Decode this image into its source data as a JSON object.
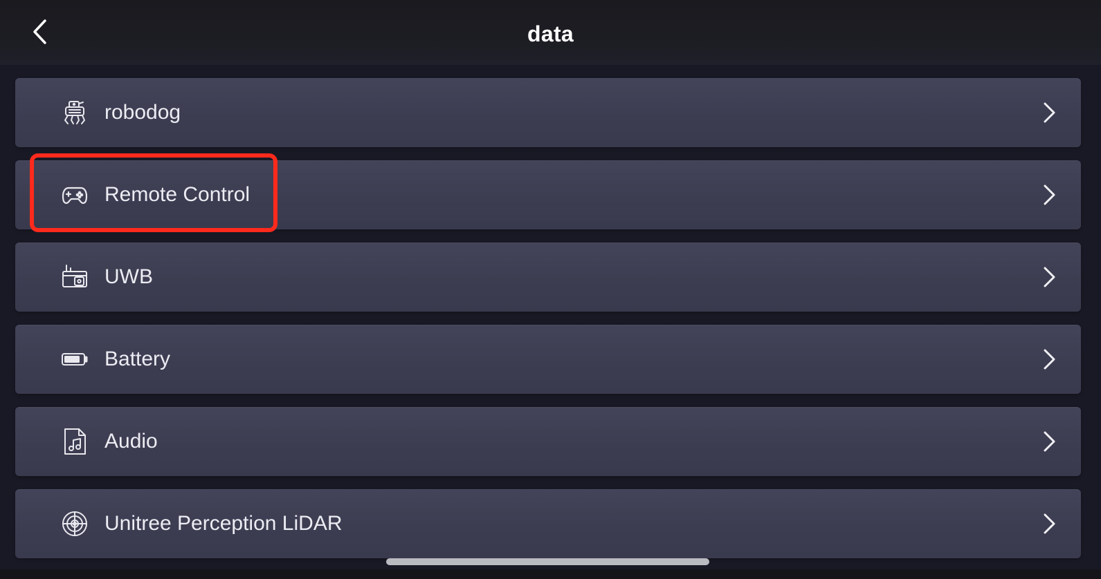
{
  "header": {
    "title": "data",
    "back_icon": "chevron-left-icon"
  },
  "items": [
    {
      "label": "robodog",
      "icon": "robot-dog-icon"
    },
    {
      "label": "Remote Control",
      "icon": "gamepad-icon",
      "highlighted": true
    },
    {
      "label": "UWB",
      "icon": "uwb-module-icon"
    },
    {
      "label": "Battery",
      "icon": "battery-icon"
    },
    {
      "label": "Audio",
      "icon": "music-file-icon"
    },
    {
      "label": "Unitree Perception LiDAR",
      "icon": "radar-icon"
    }
  ],
  "colors": {
    "background": "#191925",
    "item_background": "#3e3e54",
    "text": "#ececf3",
    "highlight": "#ff2a1c"
  }
}
